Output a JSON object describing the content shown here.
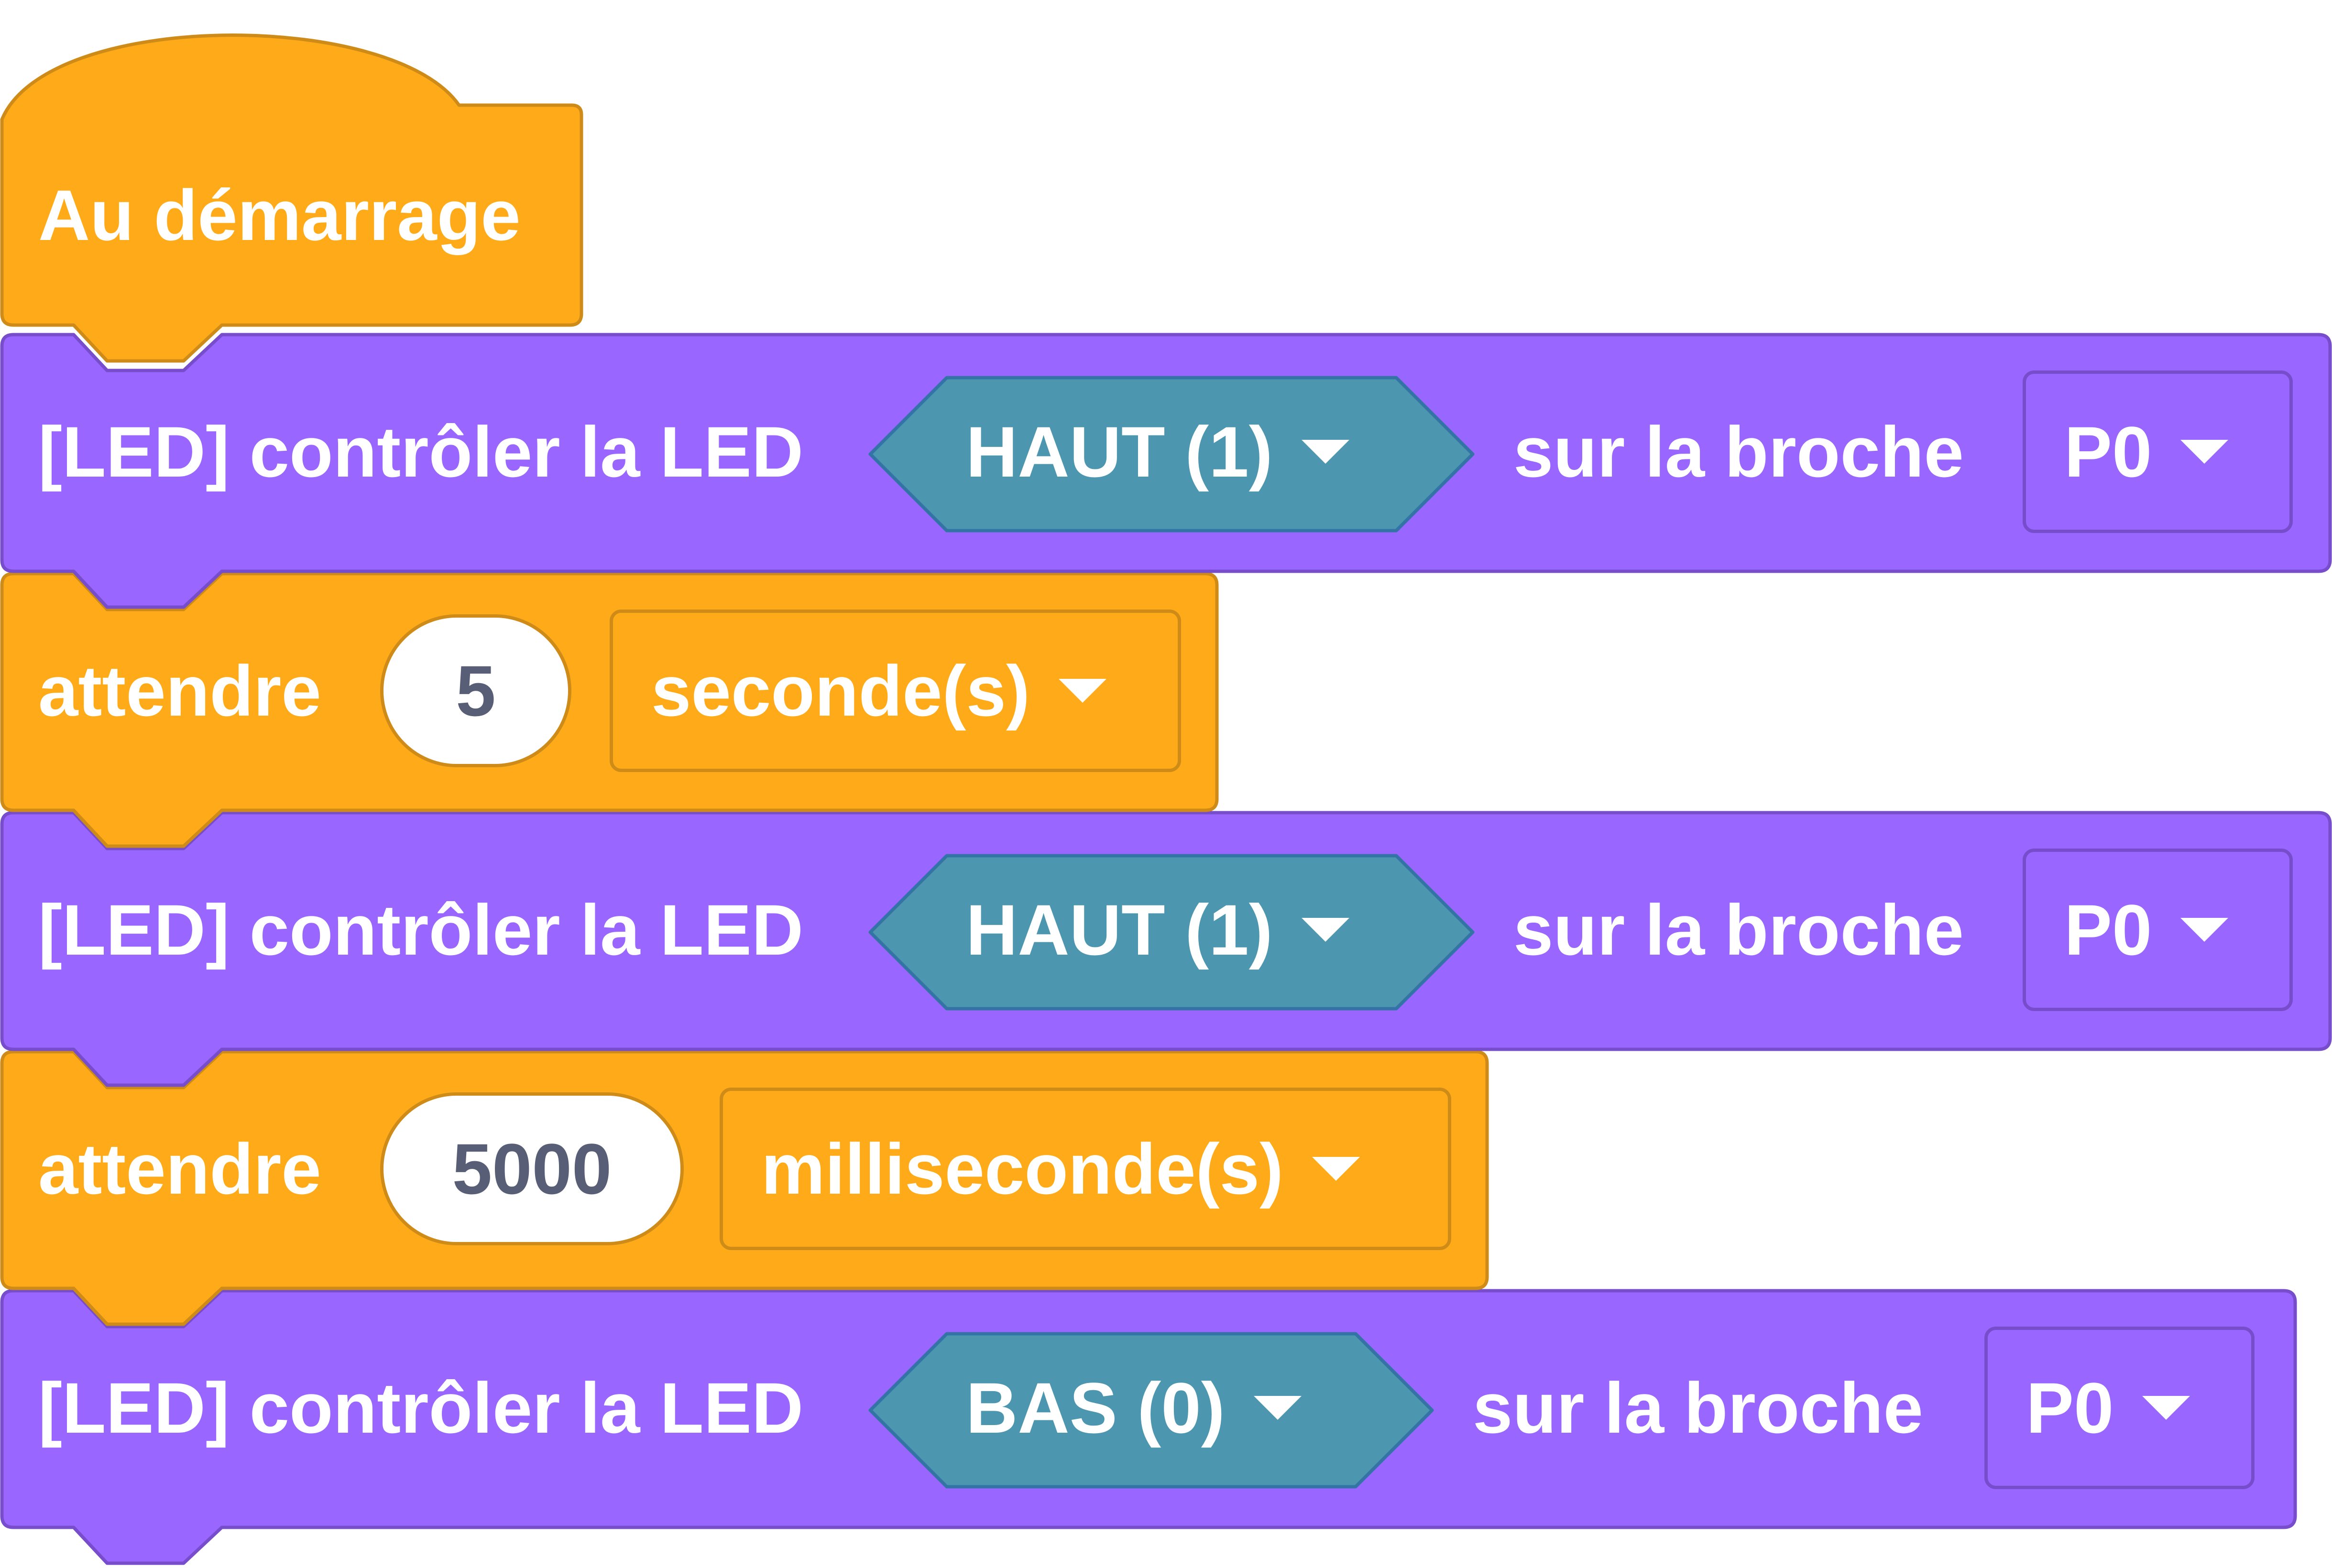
{
  "hat": {
    "label": "Au démarrage"
  },
  "blocks": [
    {
      "kind": "led",
      "label": "[LED] contrôler la LED",
      "state": "HAUT (1)",
      "pin_label": "sur la broche",
      "pin": "P0"
    },
    {
      "kind": "wait",
      "label": "attendre",
      "value": "5",
      "unit": "seconde(s)"
    },
    {
      "kind": "led",
      "label": "[LED] contrôler la LED",
      "state": "HAUT (1)",
      "pin_label": "sur la broche",
      "pin": "P0"
    },
    {
      "kind": "wait",
      "label": "attendre",
      "value": "5000",
      "unit": "milliseconde(s)"
    },
    {
      "kind": "led",
      "label": "[LED] contrôler la LED",
      "state": "BAS (0)",
      "pin_label": "sur la broche",
      "pin": "P0"
    }
  ],
  "colors": {
    "event": "#ffab19",
    "event_border": "#cf8b17",
    "led": "#9966ff",
    "led_border": "#774dcb",
    "reporter": "#4c97af",
    "reporter_border": "#3373a5",
    "input_text": "#575e75"
  },
  "icons": {
    "dropdown": "chevron-down-icon"
  }
}
